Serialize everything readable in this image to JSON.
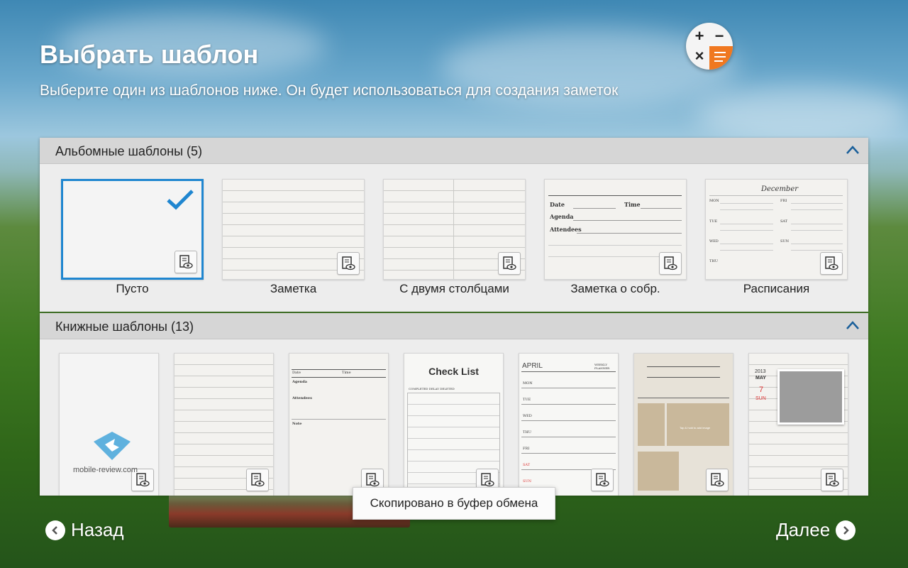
{
  "header": {
    "title": "Выбрать шаблон",
    "subtitle": "Выберите один из шаблонов ниже. Он будет использоваться для создания заметок",
    "app_icon": "calculator-memo-icon"
  },
  "landscape_section": {
    "label": "Альбомные шаблоны (5)",
    "collapse_icon": "chevron-up-icon",
    "templates": [
      {
        "label": "Пусто",
        "selected": true
      },
      {
        "label": "Заметка",
        "selected": false
      },
      {
        "label": "С двумя столбцами",
        "selected": false
      },
      {
        "label": "Заметка о собр.",
        "selected": false
      },
      {
        "label": "Расписания",
        "selected": false
      }
    ],
    "meeting_fields": {
      "date": "Date",
      "time": "Time",
      "agenda": "Agenda",
      "attendees": "Attendees"
    },
    "schedule": {
      "month": "December",
      "days_left": [
        "MON",
        "TUE",
        "WED",
        "THU"
      ],
      "days_right": [
        "FRI",
        "SAT",
        "SUN"
      ]
    }
  },
  "portrait_section": {
    "label": "Книжные шаблоны (13)",
    "collapse_icon": "chevron-up-icon",
    "meeting_fields": {
      "date": "Date",
      "time": "Time",
      "agenda": "Agenda",
      "attendees": "Attendees",
      "note": "Note"
    },
    "checklist": {
      "title": "Check List",
      "legend": "COMPLETED  DELAY  DELETED"
    },
    "planner": {
      "month": "APRIL",
      "tag": "WEEKLY PLANNER",
      "days": [
        "MON",
        "TUE",
        "WED",
        "THU",
        "FRI",
        "SAT",
        "SUN"
      ]
    },
    "photo_caption": "Tap & hold to add image",
    "calendar": {
      "year": "2013",
      "month": "MAY",
      "day": "7",
      "weekday": "SUN"
    }
  },
  "watermark": "mobile-review.com",
  "toast": "Скопировано в буфер обмена",
  "nav": {
    "back": "Назад",
    "next": "Далее"
  },
  "colors": {
    "accent": "#1f86d0",
    "panel_header": "#d6d6d6",
    "panel_body": "#ededed"
  }
}
